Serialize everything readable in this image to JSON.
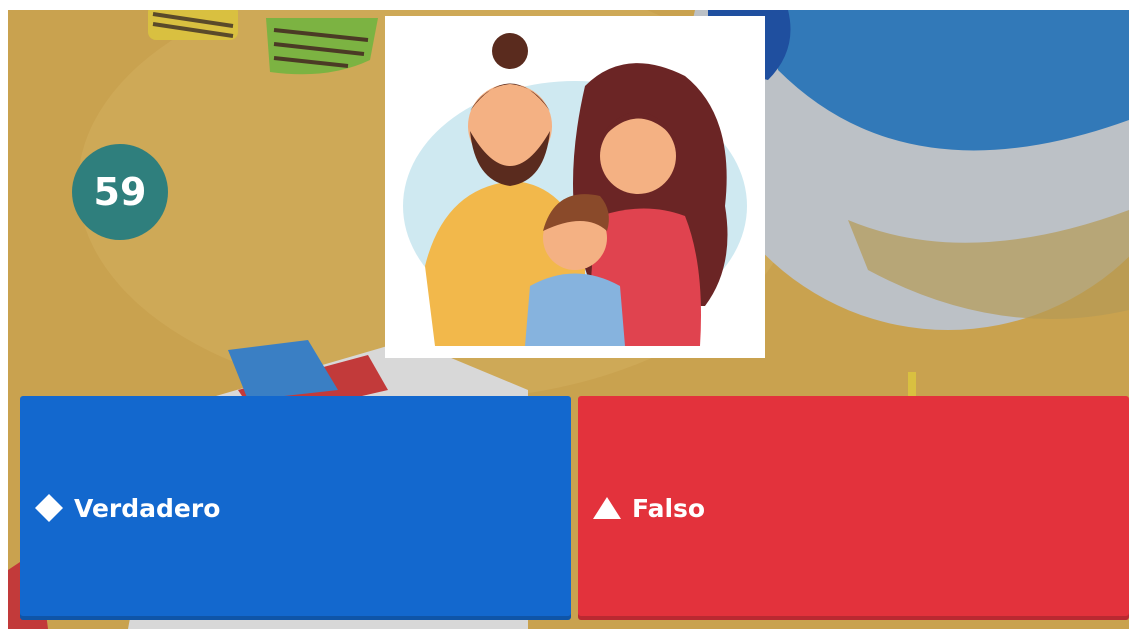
{
  "timer": {
    "seconds": "59"
  },
  "question": {
    "image": "family-illustration"
  },
  "answers": [
    {
      "label": "Verdadero",
      "shape": "diamond-icon",
      "color": "#1368ce"
    },
    {
      "label": "Falso",
      "shape": "triangle-icon",
      "color": "#e3323c"
    }
  ],
  "colors": {
    "background": "#c9a24f",
    "timer": "#2f7f7d"
  }
}
